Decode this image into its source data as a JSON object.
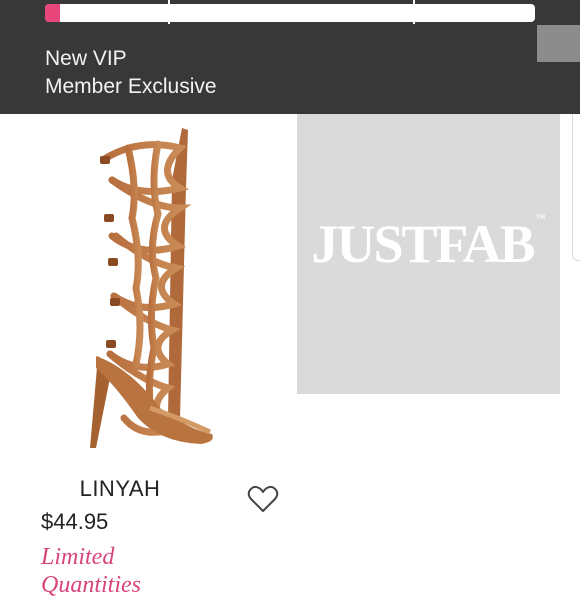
{
  "banner": {
    "title_line1": "New VIP",
    "title_line2": "Member Exclusive",
    "progress": 0.03,
    "accent_color": "#e8457a"
  },
  "products": [
    {
      "name": "LINYAH",
      "price": "$44.95",
      "badge": "Limited Quantities",
      "image_icon": "gladiator-sandal-image",
      "favorite_icon": "heart-outline-icon"
    },
    {
      "placeholder_logo": "JUSTFAB",
      "placeholder_mark": "™"
    }
  ]
}
